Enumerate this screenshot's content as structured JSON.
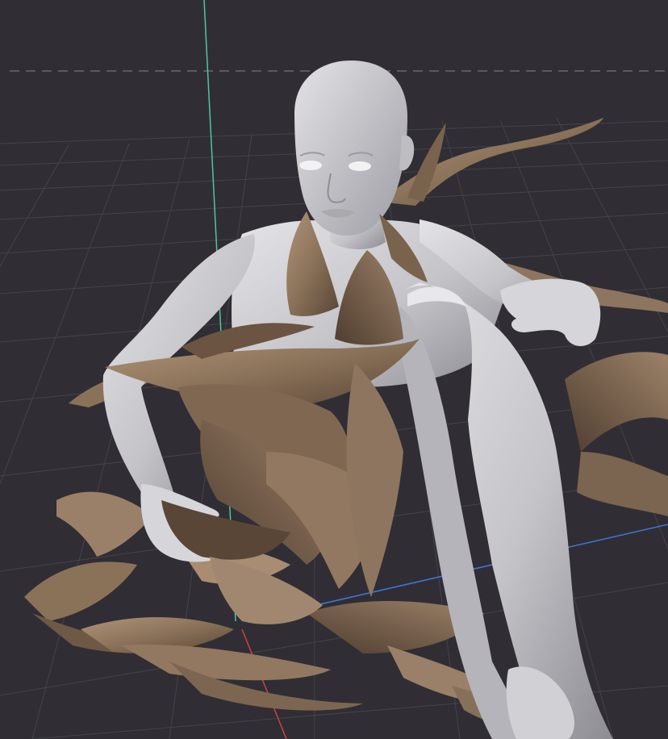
{
  "viewport": {
    "kind": "3d-viewport",
    "background_color": "#302e34",
    "grid_color": "#45434a",
    "axis_colors": {
      "x": "#c8443f",
      "y": "#3c78d8",
      "z": "#4fc6a0"
    }
  },
  "scene": {
    "figure": {
      "name": "figure-mannequin",
      "skin_color": "#c7c7cc"
    },
    "cloth": {
      "name": "ribbon-cloth",
      "color": "#8a7259",
      "shadow_color": "#5a4636",
      "highlight_color": "#b89c80"
    }
  }
}
